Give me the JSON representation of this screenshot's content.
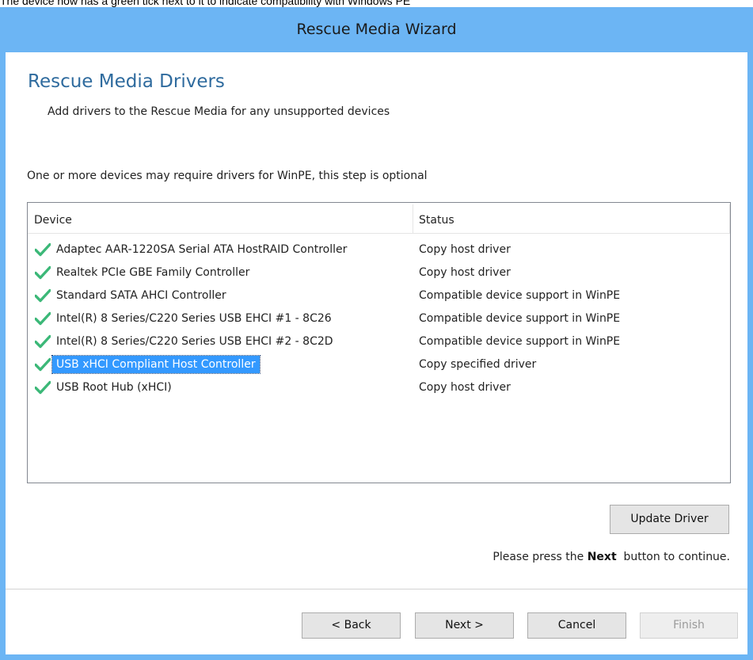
{
  "caption": "The device now has a green tick next to it to indicate compatibility with Windows PE",
  "window": {
    "title": "Rescue Media Wizard"
  },
  "page": {
    "title": "Rescue Media Drivers",
    "subtitle": "Add drivers to the Rescue Media for any unsupported devices",
    "info": "One or more devices may require drivers for WinPE, this step is optional"
  },
  "table": {
    "columns": [
      "Device",
      "Status"
    ],
    "rows": [
      {
        "icon": "green-check-icon",
        "device": "Adaptec AAR-1220SA Serial ATA HostRAID Controller",
        "status": "Copy host driver",
        "selected": false
      },
      {
        "icon": "green-check-icon",
        "device": "Realtek PCIe GBE Family Controller",
        "status": "Copy host driver",
        "selected": false
      },
      {
        "icon": "green-check-icon",
        "device": "Standard SATA AHCI Controller",
        "status": "Compatible device support in WinPE",
        "selected": false
      },
      {
        "icon": "green-check-icon",
        "device": "Intel(R) 8 Series/C220 Series USB EHCI #1 - 8C26",
        "status": "Compatible device support in WinPE",
        "selected": false
      },
      {
        "icon": "green-check-icon",
        "device": "Intel(R) 8 Series/C220 Series USB EHCI #2 - 8C2D",
        "status": "Compatible device support in WinPE",
        "selected": false
      },
      {
        "icon": "green-check-icon",
        "device": "USB xHCI Compliant Host Controller",
        "status": "Copy specified driver",
        "selected": true
      },
      {
        "icon": "green-check-icon",
        "device": "USB Root Hub (xHCI)",
        "status": "Copy host driver",
        "selected": false
      }
    ]
  },
  "buttons": {
    "update_driver": "Update Driver",
    "back": "< Back",
    "next": "Next >",
    "cancel": "Cancel",
    "finish": "Finish"
  },
  "hint": {
    "before": "Please press the ",
    "bold": "Next",
    "after": "  button to continue."
  },
  "colors": {
    "title_bar": "#6cb5f4",
    "page_title": "#2f6b9e",
    "selection": "#3399ff",
    "check": "#3cb878"
  }
}
